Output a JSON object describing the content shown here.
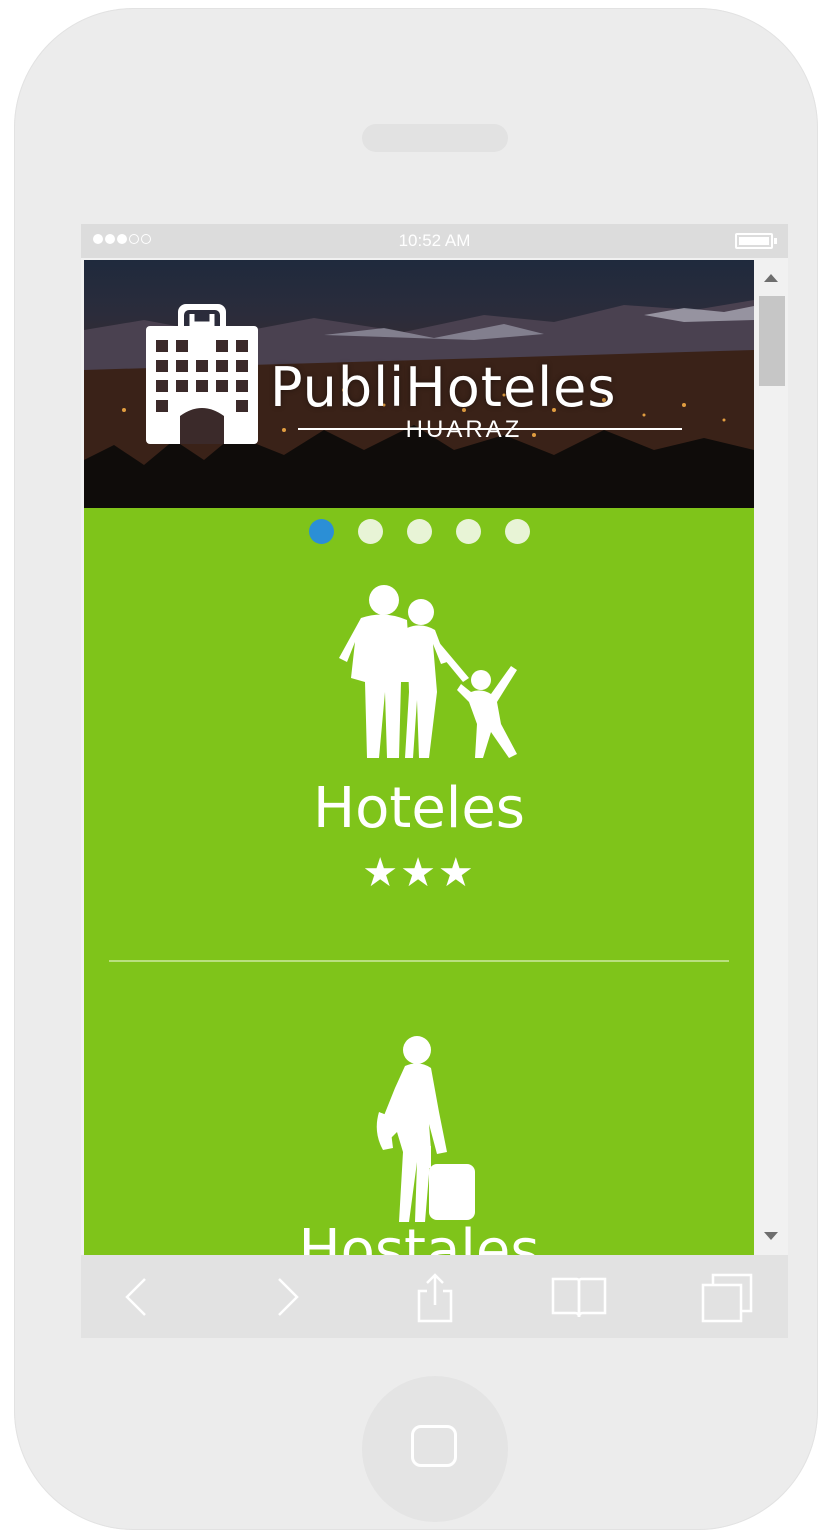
{
  "status_bar": {
    "time": "10:52 AM"
  },
  "hero": {
    "brand": "PubliHoteles",
    "subtitle": "HUARAZ"
  },
  "carousel": {
    "active_index": 0,
    "count": 5
  },
  "sections": [
    {
      "title": "Hoteles",
      "stars": "★★★"
    },
    {
      "title": "Hostales"
    }
  ],
  "toolbar": {
    "back_icon": "chevron-left-icon",
    "forward_icon": "chevron-right-icon",
    "share_icon": "share-icon",
    "bookmarks_icon": "book-icon",
    "tabs_icon": "tabs-icon"
  },
  "colors": {
    "content_green": "#7fc41a",
    "active_dot": "#2b8fd6",
    "inactive_dot": "#e8f4d6"
  }
}
